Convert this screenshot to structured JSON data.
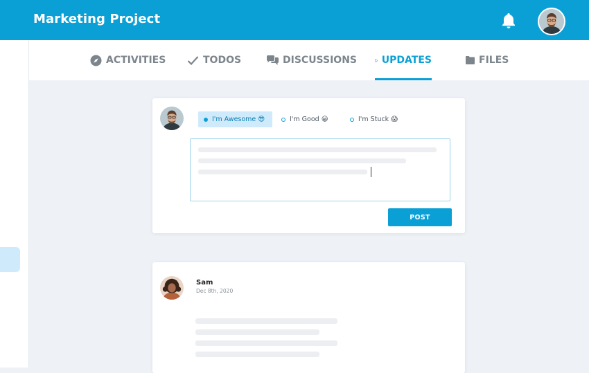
{
  "header": {
    "title": "Marketing Project"
  },
  "tabs": [
    {
      "label": "ACTIVITIES",
      "icon": "compass-icon",
      "active": false
    },
    {
      "label": "TODOS",
      "icon": "check-icon",
      "active": false
    },
    {
      "label": "DISCUSSIONS",
      "icon": "chat-bubbles-icon",
      "active": false
    },
    {
      "label": "UPDATES",
      "icon": "edit-document-icon",
      "active": true
    },
    {
      "label": "FILES",
      "icon": "folder-icon",
      "active": false
    }
  ],
  "composer": {
    "moods": [
      {
        "label": "I'm Awesome 😎",
        "selected": true
      },
      {
        "label": "I'm Good 😀",
        "selected": false
      },
      {
        "label": "I'm Stuck 😱",
        "selected": false
      }
    ],
    "post_label": "POST"
  },
  "feed": {
    "posts": [
      {
        "author": "Sam",
        "date": "Dec 8th, 2020"
      }
    ]
  },
  "colors": {
    "accent": "#0aa0d6",
    "accent_light": "#cfeafb",
    "background": "#eef2f7"
  }
}
